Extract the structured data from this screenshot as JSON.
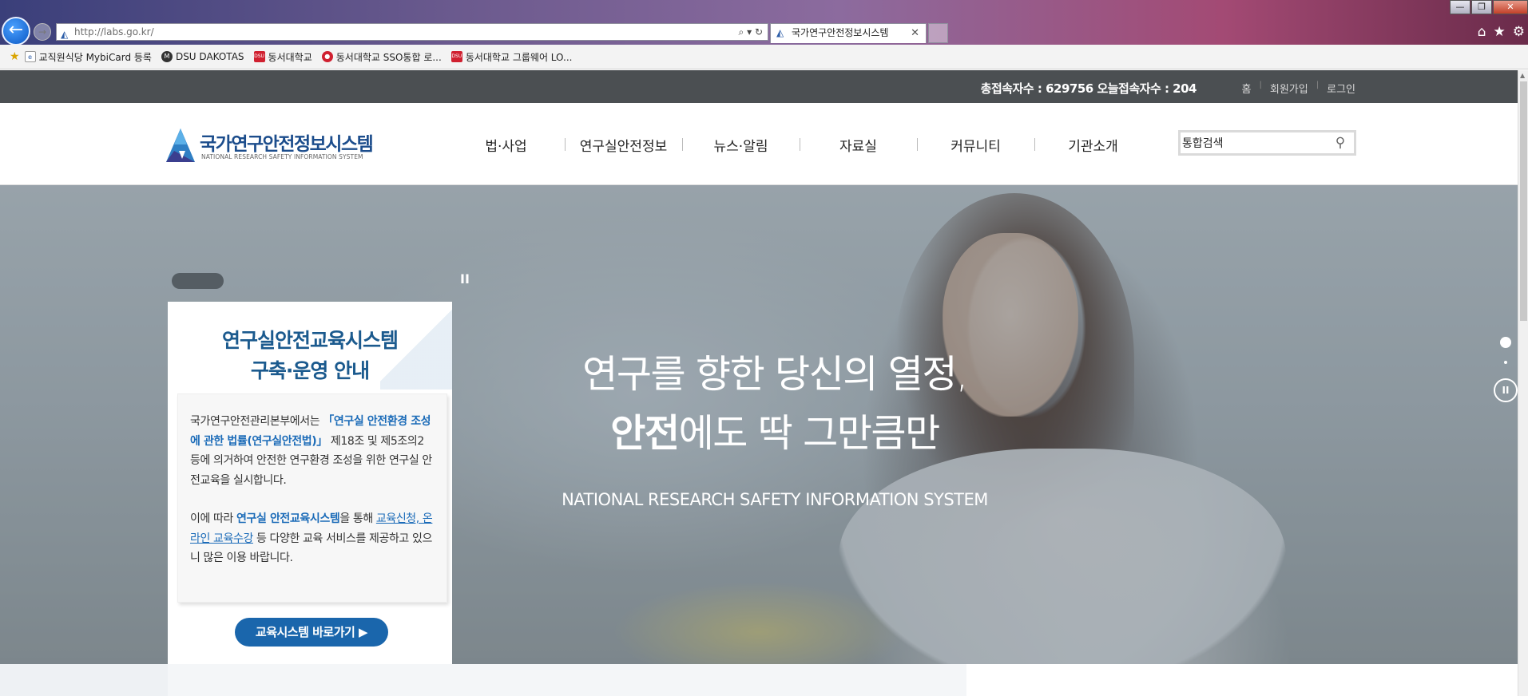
{
  "browser": {
    "url": "http://labs.go.kr/",
    "tab_title": "국가연구안전정보시스템",
    "tab_close": "✕",
    "window_controls": [
      "—",
      "❐",
      "✕"
    ],
    "favorites": [
      {
        "label": "교직원식당 MybiCard 등록",
        "icon": "page-icon"
      },
      {
        "label": "DSU DAKOTAS",
        "icon": "dakotas-icon"
      },
      {
        "label": "동서대학교",
        "icon": "dsu-icon"
      },
      {
        "label": "동서대학교 SSO통합 로...",
        "icon": "sso-icon"
      },
      {
        "label": "동서대학교 그룹웨어 LO...",
        "icon": "dsu-icon"
      }
    ]
  },
  "site": {
    "visitor_text": "총접속자수 : 629756 오늘접속자수 : 204",
    "top_links": [
      "홈",
      "회원가입",
      "로그인"
    ],
    "logo_title": "국가연구안전정보시스템",
    "logo_sub": "NATIONAL RESEARCH SAFETY INFORMATION SYSTEM",
    "nav": [
      "법·사업",
      "연구실안전정보",
      "뉴스·알림",
      "자료실",
      "커뮤니티",
      "기관소개"
    ],
    "search_value": "통합검색"
  },
  "hero": {
    "line1": "연구를 향한 당신의 열정,",
    "line2_bold": "안전",
    "line2_rest": "에도 딱 그만큼만",
    "subtitle": "NATIONAL RESEARCH SAFETY INFORMATION SYSTEM",
    "pause": "II"
  },
  "notice": {
    "title_line1": "연구실안전교육시스템",
    "title_line2": "구축·운영 안내",
    "p1_a": "국가연구안전관리본부에서는 ",
    "p1_hl": "「연구실 안전환경 조성에 관한 법률(연구실안전법)」",
    "p1_b": " 제18조 및 제5조의2 등에 의거하여 안전한 연구환경 조성을 위한 연구실 안전교육을 실시합니다.",
    "p2_a": "이에 따라 ",
    "p2_hl": "연구실 안전교육시스템",
    "p2_b": "을 통해 ",
    "p2_ul": "교육신청, 온라인 교육수강",
    "p2_c": " 등 다양한 교육 서비스를 제공하고 있으니 많은 이용 바랍니다.",
    "button": "교육시스템 바로가기 ▶"
  }
}
